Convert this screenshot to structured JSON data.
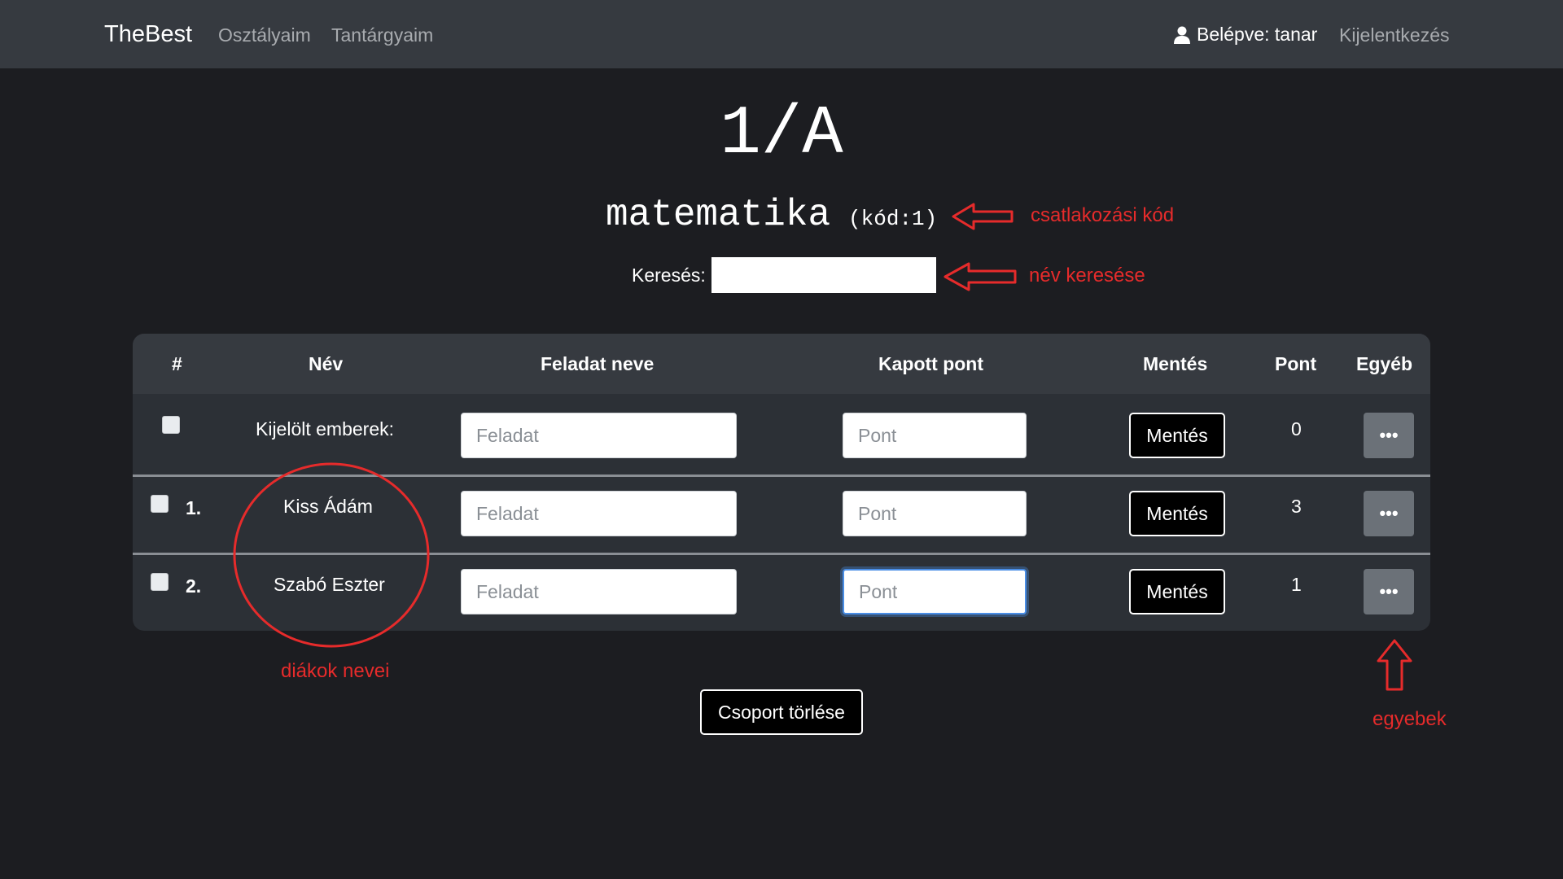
{
  "navbar": {
    "brand": "TheBest",
    "links": [
      "Osztályaim",
      "Tantárgyaim"
    ],
    "user_label": "Belépve: tanar",
    "logout": "Kijelentkezés"
  },
  "page": {
    "title": "1/A",
    "subject": "matematika",
    "code": "(kód:1)",
    "search_label": "Keresés:",
    "search_value": ""
  },
  "annotations": {
    "code": "csatlakozási kód",
    "search": "név keresése",
    "names": "diákok nevei",
    "other": "egyebek",
    "color": "#e62b2b"
  },
  "table": {
    "headers": [
      "#",
      "Név",
      "Feladat neve",
      "Kapott pont",
      "Mentés",
      "Pont",
      "Egyéb"
    ],
    "selected_row": {
      "label": "Kijelölt emberek:",
      "task_placeholder": "Feladat",
      "points_placeholder": "Pont",
      "save_label": "Mentés",
      "points": "0",
      "more_label": "•••"
    },
    "rows": [
      {
        "num": "1.",
        "name": "Kiss Ádám",
        "task_placeholder": "Feladat",
        "points_placeholder": "Pont",
        "save_label": "Mentés",
        "points": "3",
        "more_label": "•••"
      },
      {
        "num": "2.",
        "name": "Szabó Eszter",
        "task_placeholder": "Feladat",
        "points_placeholder": "Pont",
        "save_label": "Mentés",
        "points": "1",
        "more_label": "•••"
      }
    ]
  },
  "actions": {
    "delete_group": "Csoport törlése"
  }
}
